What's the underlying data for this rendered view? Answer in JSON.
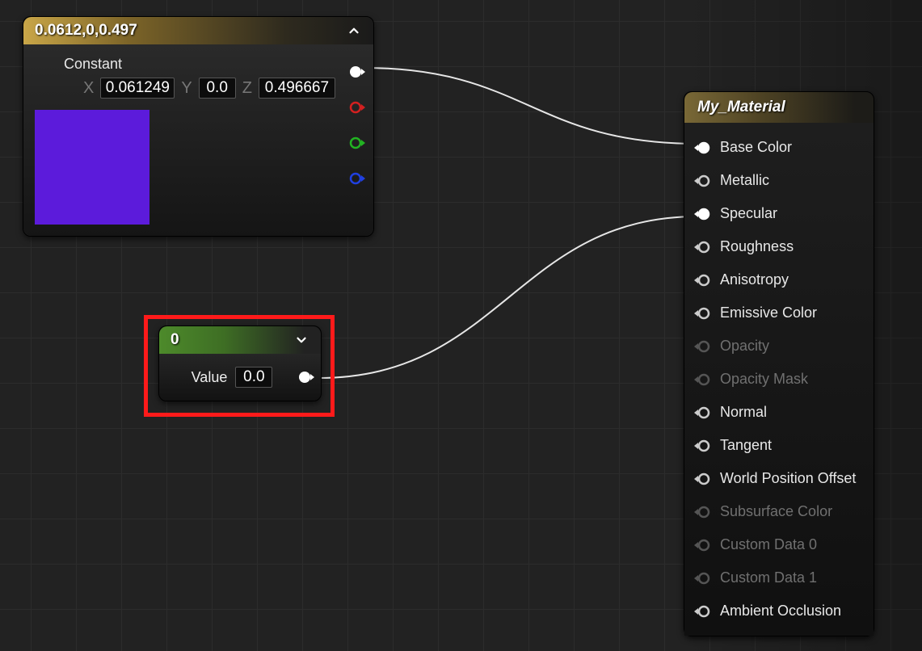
{
  "vec_node": {
    "title": "0.0612,0,0.497",
    "constant_label": "Constant",
    "x_label": "X",
    "y_label": "Y",
    "z_label": "Z",
    "x_value": "0.061249",
    "y_value": "0.0",
    "z_value": "0.496667",
    "swatch_color": "#5c1bdb"
  },
  "scalar_node": {
    "title": "0",
    "value_label": "Value",
    "value": "0.0"
  },
  "material_node": {
    "title": "My_Material",
    "inputs": [
      {
        "label": "Base Color",
        "enabled": true,
        "connected": true
      },
      {
        "label": "Metallic",
        "enabled": true,
        "connected": false
      },
      {
        "label": "Specular",
        "enabled": true,
        "connected": true
      },
      {
        "label": "Roughness",
        "enabled": true,
        "connected": false
      },
      {
        "label": "Anisotropy",
        "enabled": true,
        "connected": false
      },
      {
        "label": "Emissive Color",
        "enabled": true,
        "connected": false
      },
      {
        "label": "Opacity",
        "enabled": false,
        "connected": false
      },
      {
        "label": "Opacity Mask",
        "enabled": false,
        "connected": false
      },
      {
        "label": "Normal",
        "enabled": true,
        "connected": false
      },
      {
        "label": "Tangent",
        "enabled": true,
        "connected": false
      },
      {
        "label": "World Position Offset",
        "enabled": true,
        "connected": false
      },
      {
        "label": "Subsurface Color",
        "enabled": false,
        "connected": false
      },
      {
        "label": "Custom Data 0",
        "enabled": false,
        "connected": false
      },
      {
        "label": "Custom Data 1",
        "enabled": false,
        "connected": false
      },
      {
        "label": "Ambient Occlusion",
        "enabled": true,
        "connected": false
      }
    ]
  },
  "pins": {
    "rgba": "rgba-pin",
    "r": "r-pin",
    "g": "g-pin",
    "b": "b-pin"
  }
}
